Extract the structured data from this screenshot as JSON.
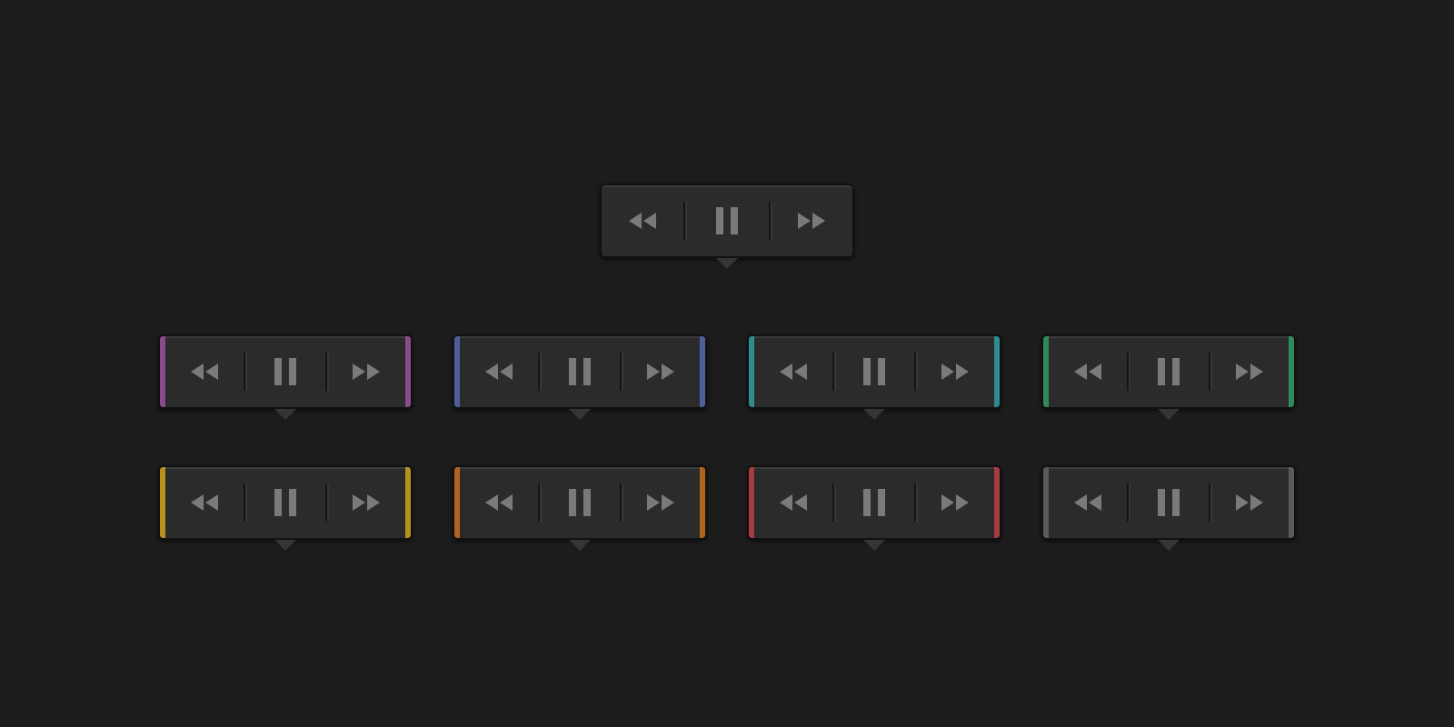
{
  "top_player": {
    "kind": "plain"
  },
  "player_rows": [
    [
      {
        "kind": "accented",
        "color": "#8a4a8c"
      },
      {
        "kind": "accented",
        "color": "#4f5f9c"
      },
      {
        "kind": "accented",
        "color": "#2f8c8f"
      },
      {
        "kind": "accented",
        "color": "#2f8a5a"
      }
    ],
    [
      {
        "kind": "accented",
        "color": "#b8921f"
      },
      {
        "kind": "accented",
        "color": "#b0641f"
      },
      {
        "kind": "accented",
        "color": "#a83a42"
      },
      {
        "kind": "accented",
        "color": "#5a5a5a"
      }
    ]
  ]
}
